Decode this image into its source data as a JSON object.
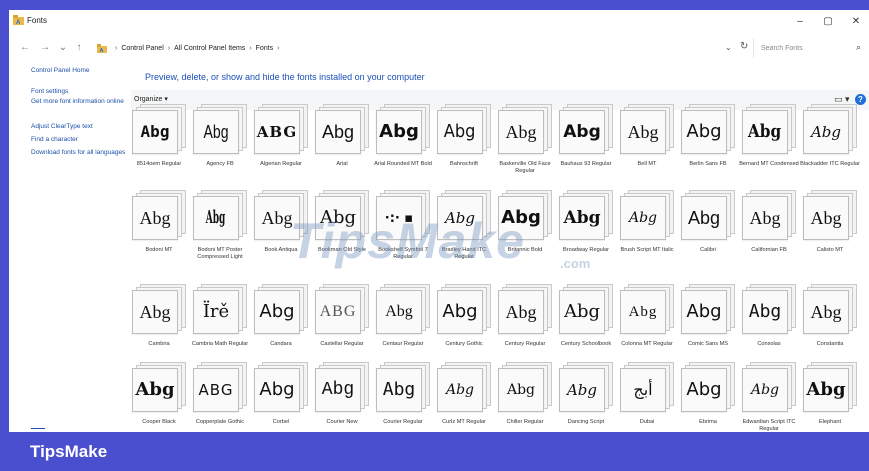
{
  "window": {
    "title": "Fonts"
  },
  "titlebar": {
    "minimize": "–",
    "maximize": "▢",
    "close": "✕"
  },
  "nav": {
    "back": "←",
    "forward": "→",
    "recent": "⌄",
    "up": "↑"
  },
  "breadcrumb": [
    "Control Panel",
    "All Control Panel Items",
    "Fonts"
  ],
  "search": {
    "placeholder": "Search Fonts"
  },
  "leftpane": {
    "home": "Control Panel Home",
    "settings": "Font settings",
    "online": "Get more font information online",
    "cleartype": "Adjust ClearType text",
    "findchar": "Find a character",
    "download": "Download fonts for all languages"
  },
  "main": {
    "heading": "Preview, delete, or show and hide the fonts installed on your computer",
    "organize": "Organize ▾",
    "view_icon": "▭ ▾",
    "help_icon": "?"
  },
  "fonts": [
    {
      "name": "8514oem Regular",
      "sample": "Abg"
    },
    {
      "name": "Agency FB",
      "sample": "Abg"
    },
    {
      "name": "Algerian Regular",
      "sample": "ABG"
    },
    {
      "name": "Arial",
      "sample": "Abg"
    },
    {
      "name": "Arial Rounded MT Bold",
      "sample": "Abg"
    },
    {
      "name": "Bahnschrift",
      "sample": "Abg"
    },
    {
      "name": "Baskerville Old Face Regular",
      "sample": "Abg"
    },
    {
      "name": "Bauhaus 93 Regular",
      "sample": "Abg"
    },
    {
      "name": "Bell MT",
      "sample": "Abg"
    },
    {
      "name": "Berlin Sans FB",
      "sample": "Abg"
    },
    {
      "name": "Bernard MT Condensed",
      "sample": "Abg"
    },
    {
      "name": "Blackadder ITC Regular",
      "sample": "Abg"
    },
    {
      "name": "Bodoni MT",
      "sample": "Abg"
    },
    {
      "name": "Bodoni MT Poster Compressed Light",
      "sample": "Abg"
    },
    {
      "name": "Book Antiqua",
      "sample": "Abg"
    },
    {
      "name": "Bookman Old Style",
      "sample": "Abg"
    },
    {
      "name": "Bookshelf Symbol 7 Regular",
      "sample": "·:· ▪"
    },
    {
      "name": "Bradley Hand ITC Regular",
      "sample": "Abg"
    },
    {
      "name": "Britannic Bold",
      "sample": "Abg"
    },
    {
      "name": "Broadway Regular",
      "sample": "Abg"
    },
    {
      "name": "Brush Script MT Italic",
      "sample": "Abg"
    },
    {
      "name": "Calibri",
      "sample": "Abg"
    },
    {
      "name": "Californian FB",
      "sample": "Abg"
    },
    {
      "name": "Calisto MT",
      "sample": "Abg"
    },
    {
      "name": "Cambria",
      "sample": "Abg"
    },
    {
      "name": "Cambria Math Regular",
      "sample": "Ïrě"
    },
    {
      "name": "Candara",
      "sample": "Abg"
    },
    {
      "name": "Castellar Regular",
      "sample": "ABG"
    },
    {
      "name": "Centaur Regular",
      "sample": "Abg"
    },
    {
      "name": "Century Gothic",
      "sample": "Abg"
    },
    {
      "name": "Century Regular",
      "sample": "Abg"
    },
    {
      "name": "Century Schoolbook",
      "sample": "Abg"
    },
    {
      "name": "Colonna MT Regular",
      "sample": "Abg"
    },
    {
      "name": "Comic Sans MS",
      "sample": "Abg"
    },
    {
      "name": "Consolas",
      "sample": "Abg"
    },
    {
      "name": "Constantia",
      "sample": "Abg"
    },
    {
      "name": "Cooper Black",
      "sample": "Abg"
    },
    {
      "name": "Copperplate Gothic",
      "sample": "ABG"
    },
    {
      "name": "Corbel",
      "sample": "Abg"
    },
    {
      "name": "Courier New",
      "sample": "Abg"
    },
    {
      "name": "Courier Regular",
      "sample": "Abg"
    },
    {
      "name": "Curlz MT Regular",
      "sample": "Abg"
    },
    {
      "name": "Chiller Regular",
      "sample": "Abg"
    },
    {
      "name": "Dancing Script",
      "sample": "Abg"
    },
    {
      "name": "Dubai",
      "sample": "أبج"
    },
    {
      "name": "Ebrima",
      "sample": "Abg"
    },
    {
      "name": "Edwardian Script ITC Regular",
      "sample": "Abg"
    },
    {
      "name": "Elephant",
      "sample": "Abg"
    }
  ],
  "watermark": {
    "main": "TipsMake",
    "suffix": ".com"
  },
  "footer": {
    "brand": "TipsMake"
  },
  "colors": {
    "accent": "#4a4fd0",
    "link": "#1a4fa8",
    "help": "#1f6fd6"
  }
}
